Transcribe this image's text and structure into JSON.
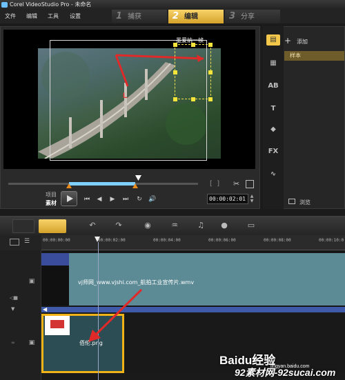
{
  "window": {
    "title": "Corel VideoStudio Pro - 未命名"
  },
  "menu": [
    "文件",
    "编辑",
    "工具",
    "设置"
  ],
  "steps": [
    {
      "num": "1",
      "label": "捕获",
      "active": false
    },
    {
      "num": "2",
      "label": "编辑",
      "active": true
    },
    {
      "num": "3",
      "label": "分享",
      "active": false
    }
  ],
  "preview": {
    "overlay_title_text": "墨爱纳一帧",
    "scrub_progress": 0.69
  },
  "transport": {
    "mode_project": "项目",
    "mode_clip": "素材",
    "timecode": "00:00:02:01"
  },
  "library": {
    "add_label": "添加",
    "folder_selected": "样本",
    "browse_label": "浏览",
    "side_icons": [
      "media-icon",
      "instant-project-icon",
      "transition-icon",
      "title-icon",
      "graphic-icon",
      "filter-icon",
      "path-icon"
    ]
  },
  "timeline": {
    "ruler_ticks": [
      "00:00:00:00",
      "00:00:02:00",
      "00:00:04:00",
      "00:00:06:00",
      "00:00:08:00",
      "00:00:10:0"
    ],
    "video_clip_label": "vj师网_www.vjshi.com_航拍工业宣传片.wmv",
    "overlay_clip_label": "佰伦.png"
  },
  "watermark": {
    "baidu": "Baidu经验",
    "baidu_sub": "jingyan.baidu.com",
    "site": "92素材网-92sucai.com"
  }
}
